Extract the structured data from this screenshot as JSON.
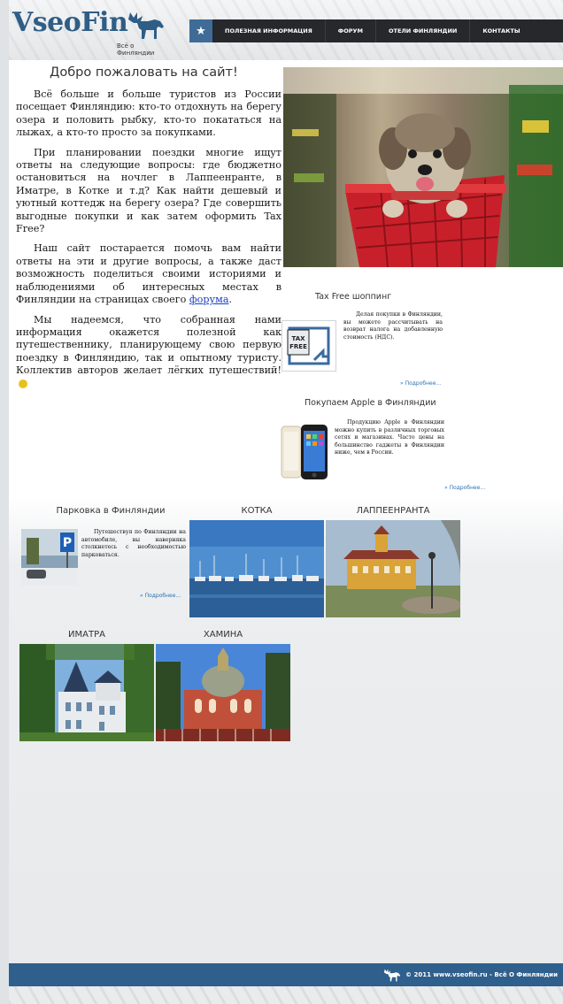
{
  "header": {
    "logo_text": "VseoFin",
    "logo_tagline": "Всё о Финляндии",
    "nav_items": [
      {
        "label": "полезная информация"
      },
      {
        "label": "форум"
      },
      {
        "label": "отели финляндии"
      },
      {
        "label": "контакты"
      }
    ]
  },
  "main": {
    "title": "Добро пожаловать на сайт!",
    "paragraphs": {
      "p1": "Всё больше и больше туристов из России посещает Финляндию: кто-то отдохнуть на берегу озера и половить рыбку, кто-то покататься на лыжах, а кто-то просто за покупками.",
      "p2": "При планировании поездки многие ищут ответы на следующие вопросы: где бюджетно остановиться на ночлег в Лаппеенранте, в Иматре, в Котке и т.д? Как найти дешевый и уютный коттедж на берегу озера? Где совершить выгодные покупки и как затем оформить Tax Free?",
      "p3_before": "Наш сайт постарается помочь вам найти ответы на эти и другие вопросы, а также даст возможность поделиться своими историями и наблюдениями об интересных местах в Финляндии на страницах своего ",
      "p3_link": "форума",
      "p3_after": ".",
      "p4": "Мы надеемся, что собранная нами информация окажется полезной как путешественнику, планирующему свою первую поездку в Финляндию, так и опытному туристу. Коллектив авторов желает лёгких путешествий!"
    }
  },
  "widgets": {
    "taxfree": {
      "title": "Tax Free шоппинг",
      "badge_line1": "TAX",
      "badge_line2": "FREE",
      "text": "Делая покупки в Финляндии, вы можете рассчитывать на возврат налога на добавленную стоимость (НДС).",
      "more": "» Подробнее..."
    },
    "apple": {
      "title": "Покупаем Apple в Финляндии",
      "text": "Продукцию Apple в Финляндии можно купить в различных торговых сетях и магазинах. Часто цены на большинство гаджеты в Финляндии ниже, чем в России.",
      "more": "» Подробнее..."
    }
  },
  "cities": {
    "parking": {
      "title": "Парковка в Финляндии",
      "text": "Путешествуя по Финляндии на автомобиле, вы наверняка столкнетесь с необходимостью парковаться.",
      "more": "» Подробнее..."
    },
    "kotka": {
      "title": "КОТКА"
    },
    "lappeenranta": {
      "title": "ЛАППЕЕНРАНТА"
    },
    "imatra": {
      "title": "ИМАТРА"
    },
    "hamina": {
      "title": "ХАМИНА"
    }
  },
  "footer": {
    "text": "© 2011 www.vseofin.ru - Всё О Финляндии"
  },
  "colors": {
    "brand_blue": "#2e5d86",
    "nav_bg": "#26282b",
    "footer_bg": "#2f5f8c",
    "link": "#1a3fbf"
  }
}
